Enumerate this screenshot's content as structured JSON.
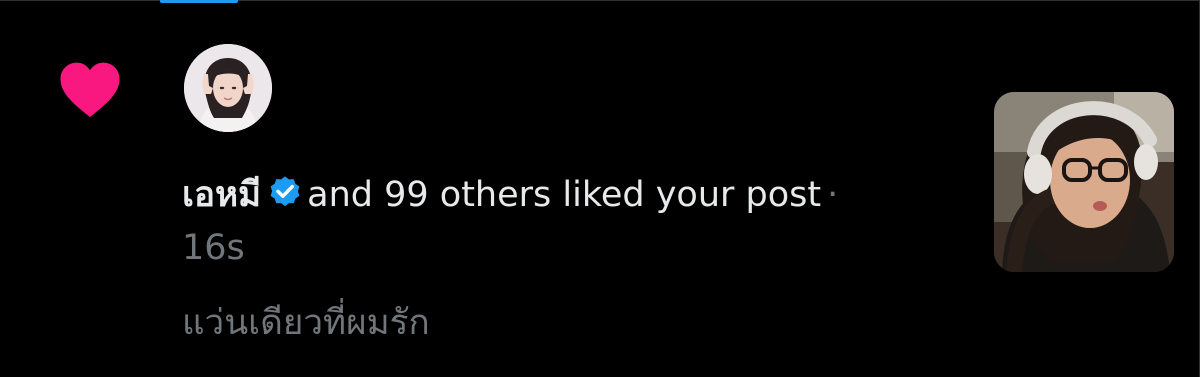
{
  "notification": {
    "type_icon": "heart-icon",
    "actor_avatar_icon": "user-avatar",
    "actor_name": "เอหมี",
    "verified_icon": "verified-badge-icon",
    "action_text": "and 99 others liked your post",
    "separator": "·",
    "time": "16s",
    "post_text": "แว่นเดียวที่ผมรัก",
    "thumbnail_icon": "post-thumbnail-image"
  },
  "colors": {
    "background": "#000000",
    "heart": "#f91880",
    "verified": "#1d9bf0",
    "primary_text": "#e7e9ea",
    "secondary_text": "#71767b"
  }
}
